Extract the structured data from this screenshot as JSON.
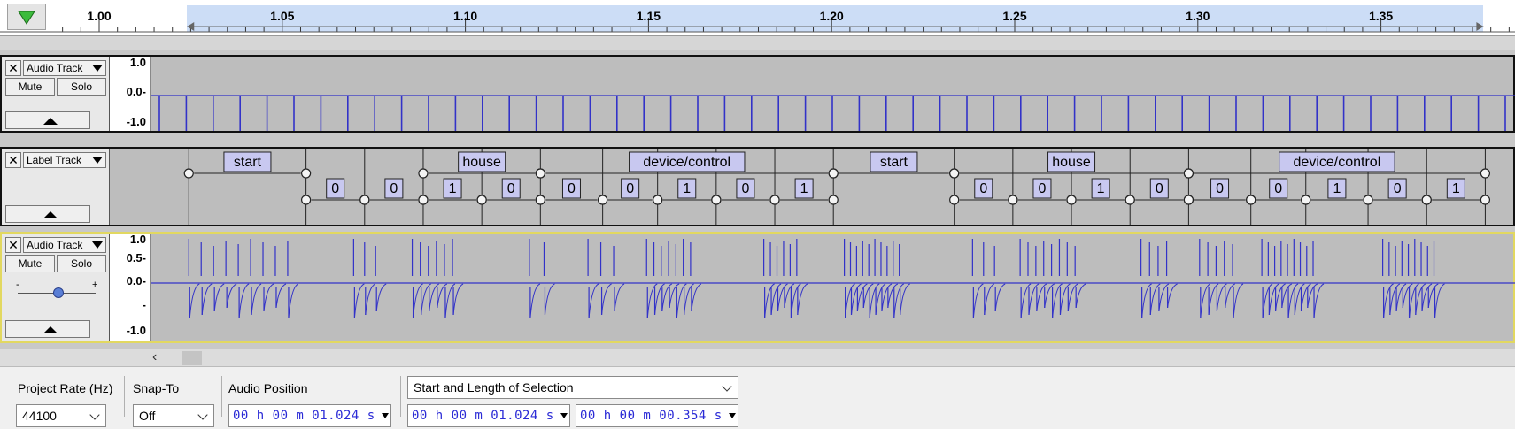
{
  "timeline": {
    "play_icon": "play-triangle-icon",
    "ruler_labels": [
      "1.00",
      "1.05",
      "1.10",
      "1.15",
      "1.20",
      "1.25",
      "1.30",
      "1.35"
    ],
    "ruler_values": [
      1.0,
      1.05,
      1.1,
      1.15,
      1.2,
      1.25,
      1.3,
      1.35
    ],
    "selection": {
      "start": 1.024,
      "end": 1.378
    }
  },
  "tracks": [
    {
      "kind": "audio",
      "name": "Audio Track",
      "mute_label": "Mute",
      "solo_label": "Solo",
      "scale_labels": [
        "1.0",
        "0.0-",
        "-1.0"
      ]
    },
    {
      "kind": "label",
      "name": "Label Track"
    },
    {
      "kind": "audio",
      "name": "Audio Track",
      "mute_label": "Mute",
      "solo_label": "Solo",
      "gain_minus": "-",
      "gain_plus": "+",
      "scale_labels": [
        "1.0",
        "0.5-",
        "0.0-",
        "-",
        "-1.0"
      ]
    }
  ],
  "label_track": {
    "upper": [
      {
        "text": "start",
        "start": 1.024,
        "end": 1.056
      },
      {
        "text": "house",
        "start": 1.088,
        "end": 1.12
      },
      {
        "text": "device/control",
        "start": 1.12,
        "end": 1.2
      },
      {
        "text": "start",
        "start": 1.2,
        "end": 1.233
      },
      {
        "text": "house",
        "start": 1.233,
        "end": 1.297
      },
      {
        "text": "device/control",
        "start": 1.297,
        "end": 1.378
      }
    ],
    "lower": [
      {
        "text": "0",
        "start": 1.056,
        "end": 1.072
      },
      {
        "text": "0",
        "start": 1.072,
        "end": 1.088
      },
      {
        "text": "1",
        "start": 1.088,
        "end": 1.104
      },
      {
        "text": "0",
        "start": 1.104,
        "end": 1.12
      },
      {
        "text": "0",
        "start": 1.12,
        "end": 1.137
      },
      {
        "text": "0",
        "start": 1.137,
        "end": 1.152
      },
      {
        "text": "1",
        "start": 1.152,
        "end": 1.168
      },
      {
        "text": "0",
        "start": 1.168,
        "end": 1.184
      },
      {
        "text": "1",
        "start": 1.184,
        "end": 1.2
      },
      {
        "text": "0",
        "start": 1.233,
        "end": 1.249
      },
      {
        "text": "0",
        "start": 1.249,
        "end": 1.265
      },
      {
        "text": "1",
        "start": 1.265,
        "end": 1.281
      },
      {
        "text": "0",
        "start": 1.281,
        "end": 1.297
      },
      {
        "text": "0",
        "start": 1.297,
        "end": 1.314
      },
      {
        "text": "0",
        "start": 1.314,
        "end": 1.329
      },
      {
        "text": "1",
        "start": 1.329,
        "end": 1.346
      },
      {
        "text": "0",
        "start": 1.346,
        "end": 1.362
      },
      {
        "text": "1",
        "start": 1.362,
        "end": 1.378
      }
    ]
  },
  "scroll": {
    "left_arrow": "‹"
  },
  "toolbar": {
    "project_rate_label": "Project Rate (Hz)",
    "project_rate_value": "44100",
    "snap_label": "Snap-To",
    "snap_value": "Off",
    "audio_position_label": "Audio Position",
    "audio_position_value": "00 h 00 m 01.024 s",
    "selection_mode_value": "Start and Length of Selection",
    "selection_start_value": "00 h 00 m 01.024 s",
    "selection_length_value": "00 h 00 m 00.354 s"
  },
  "colors": {
    "waveform": "#3232c8",
    "label_box": "#c8c8f0",
    "selection": "#ccddf6",
    "track_focus": "#e8e070"
  }
}
